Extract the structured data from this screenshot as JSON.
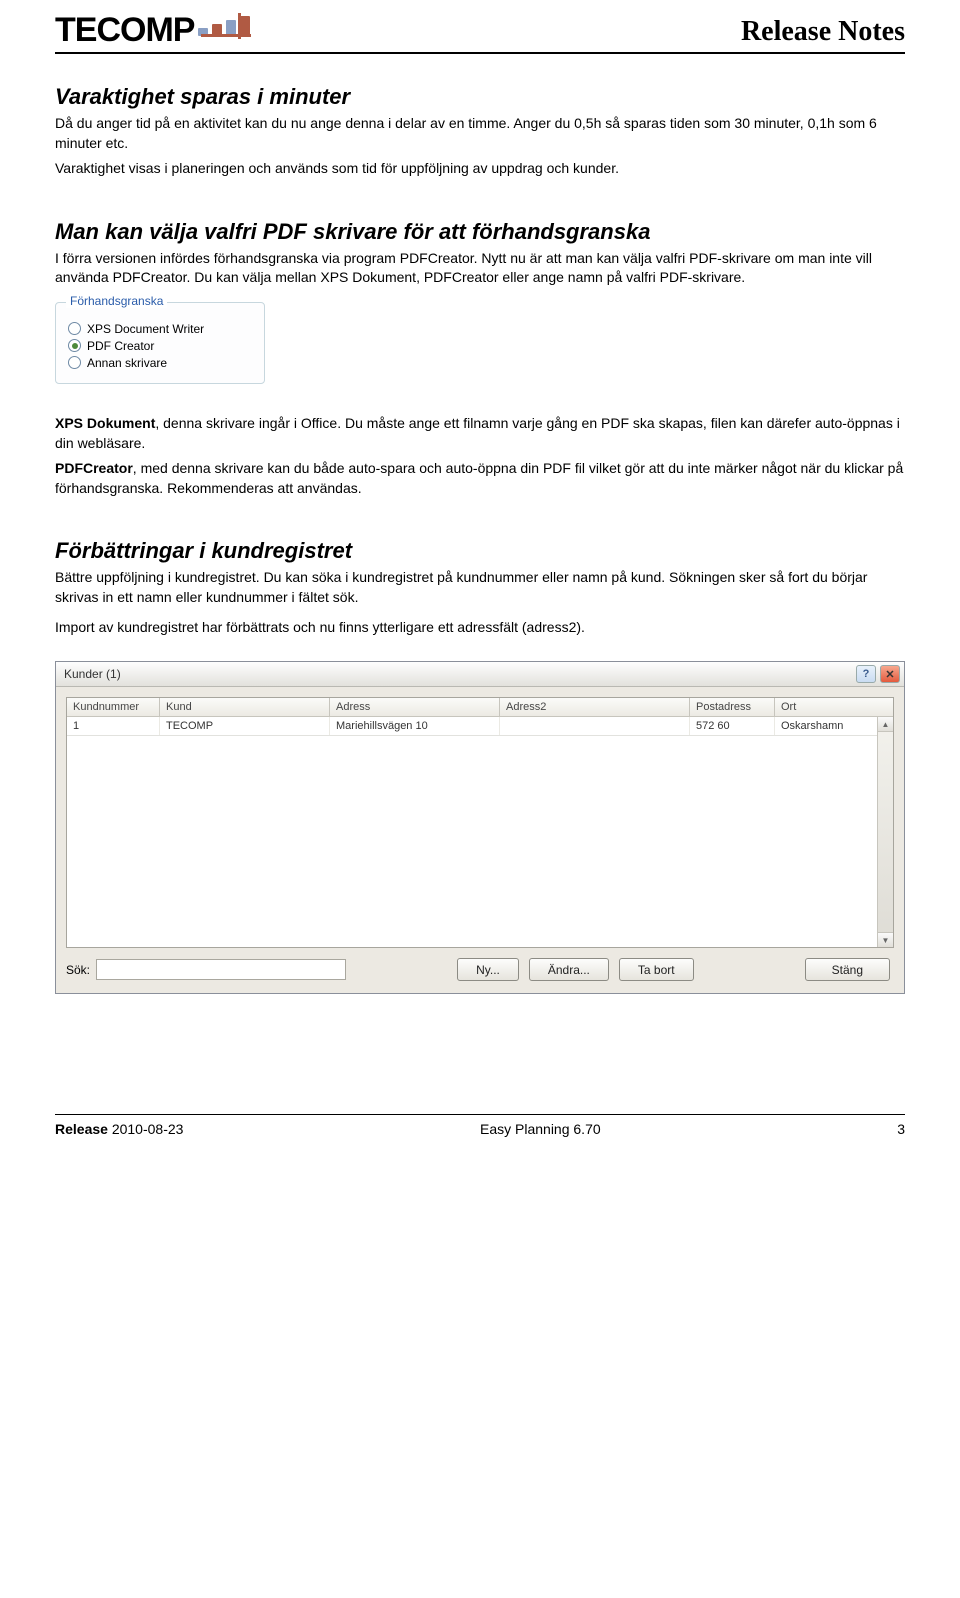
{
  "header": {
    "logo_text": "TECOMP",
    "doc_title": "Release Notes"
  },
  "section1": {
    "title": "Varaktighet sparas i minuter",
    "p1": "Då du anger tid på en aktivitet kan du nu ange denna i delar av en timme. Anger du 0,5h så sparas tiden som 30 minuter, 0,1h som 6 minuter etc.",
    "p2": "Varaktighet visas i planeringen och används som tid för uppföljning av uppdrag och kunder."
  },
  "section2": {
    "title": "Man kan välja valfri PDF skrivare för att förhandsgranska",
    "p1": "I förra versionen infördes förhandsgranska via program PDFCreator. Nytt nu är att man kan välja valfri PDF-skrivare om man inte vill använda PDFCreator. Du kan välja mellan XPS Dokument, PDFCreator eller ange namn på valfri PDF-skrivare."
  },
  "preview_box": {
    "legend": "Förhandsgranska",
    "options": [
      {
        "label": "XPS Document Writer",
        "checked": false
      },
      {
        "label": "PDF Creator",
        "checked": true
      },
      {
        "label": "Annan skrivare",
        "checked": false
      }
    ]
  },
  "section2_below": {
    "p1a": "XPS Dokument",
    "p1b": ", denna skrivare ingår i Office. Du måste ange ett filnamn varje gång en PDF ska skapas, filen kan därefer auto-öppnas i din webläsare.",
    "p2a": "PDFCreator",
    "p2b": ", med denna skrivare kan du både auto-spara och auto-öppna din PDF fil vilket gör att du inte märker något när du klickar på förhandsgranska. Rekommenderas att användas."
  },
  "section3": {
    "title": "Förbättringar i kundregistret",
    "p1": "Bättre uppföljning i kundregistret. Du kan söka i kundregistret på kundnummer eller namn på kund. Sökningen sker så fort du börjar skrivas in ett namn eller kundnummer i fältet sök.",
    "p2": "Import av kundregistret har förbättrats och nu finns ytterligare ett adressfält (adress2)."
  },
  "kunder_window": {
    "title": "Kunder (1)",
    "columns": [
      "Kundnummer",
      "Kund",
      "Adress",
      "Adress2",
      "Postadress",
      "Ort"
    ],
    "rows": [
      {
        "kn": "1",
        "kd": "TECOMP",
        "ad": "Mariehillsvägen 10",
        "a2": "",
        "pa": "572 60",
        "or": "Oskarshamn"
      }
    ],
    "search_label": "Sök:",
    "buttons": {
      "ny": "Ny...",
      "andra": "Ändra...",
      "tabort": "Ta bort",
      "stang": "Stäng"
    }
  },
  "footer": {
    "left_b": "Release",
    "left_rest": " 2010-08-23",
    "center": "Easy Planning 6.70",
    "right": "3"
  }
}
